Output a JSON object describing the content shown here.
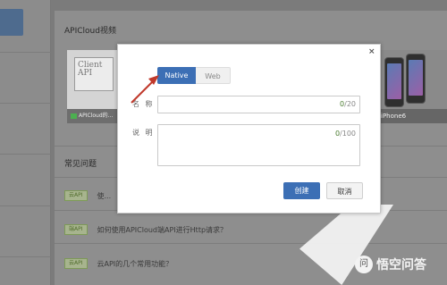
{
  "background": {
    "video_section_title": "APICloud视频",
    "video_caption": "APICloud的...",
    "board_text": "Client\nAPI",
    "phone_caption": "iPhone6",
    "faq_title": "常见问题",
    "faq_items": [
      {
        "badge": "云API",
        "text": "使..."
      },
      {
        "badge": "端API",
        "text": "如何使用APICloud端API进行Http请求？"
      },
      {
        "badge": "云API",
        "text": "云API的几个常用功能？"
      }
    ]
  },
  "modal": {
    "close_icon": "×",
    "tabs": [
      {
        "label": "Native",
        "active": true
      },
      {
        "label": "Web",
        "active": false
      }
    ],
    "name_label": "名 称",
    "name_count": "0",
    "name_max": "/20",
    "desc_label": "说 明",
    "desc_count": "0",
    "desc_max": "/100",
    "create_button": "创建",
    "cancel_button": "取消"
  },
  "watermark": {
    "icon": "问",
    "text": "悟空问答"
  },
  "colors": {
    "primary": "#3c6fb5",
    "overlay": "#7b7b7b",
    "arrow": "#c0392b"
  }
}
